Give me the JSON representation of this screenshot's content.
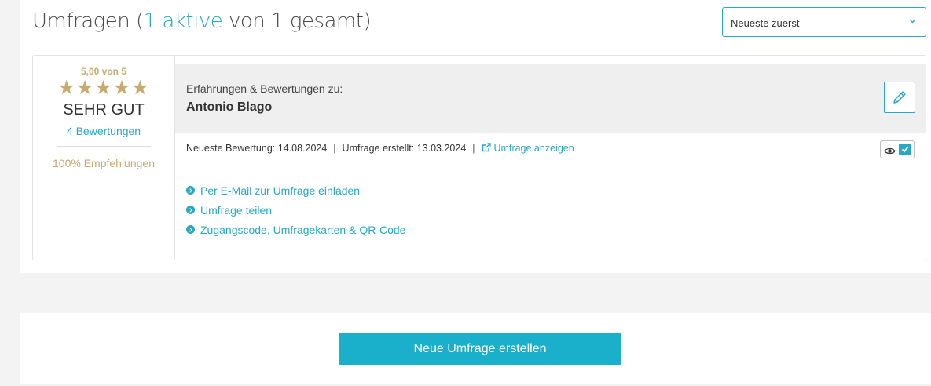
{
  "header": {
    "title_prefix": "Umfragen (",
    "title_active": "1 aktive",
    "title_suffix": " von 1 gesamt)"
  },
  "sort": {
    "selected": "Neueste zuerst",
    "icon": "chevron-down-icon"
  },
  "survey": {
    "rating": {
      "score_text": "5,00 von 5",
      "stars": 5,
      "stars_max": 5,
      "stars_text": "★★★★★",
      "verdict": "SEHR GUT",
      "reviews_count": "4 Bewertungen",
      "recommendations": "100% Empfehlungen"
    },
    "heading_sub": "Erfahrungen & Bewertungen zu:",
    "heading_name": "Antonio Blago",
    "meta": {
      "latest_review": "Neueste Bewertung: 14.08.2024",
      "created": "Umfrage erstellt: 13.03.2024",
      "view_link": "Umfrage anzeigen",
      "separator": "|"
    },
    "actions": [
      {
        "label": "Per E-Mail zur Umfrage einladen"
      },
      {
        "label": "Umfrage teilen"
      },
      {
        "label": "Zugangscode, Umfragekarten & QR-Code"
      }
    ],
    "visible": true
  },
  "footer": {
    "create_button": "Neue Umfrage erstellen"
  },
  "colors": {
    "accent": "#27a9c6",
    "gold": "#c9a96e",
    "button": "#1aafca"
  }
}
